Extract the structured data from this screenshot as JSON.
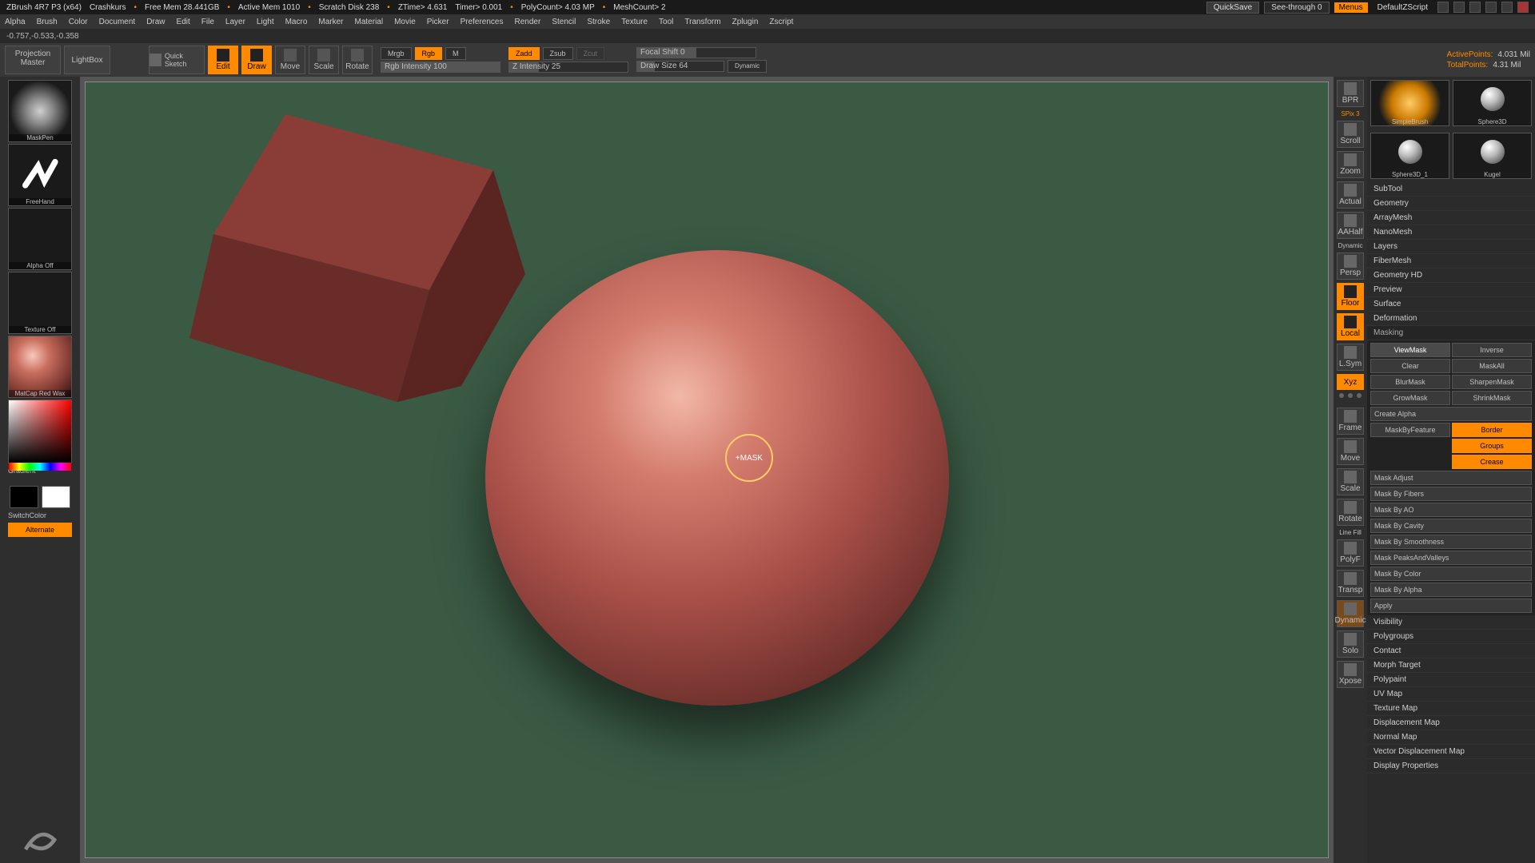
{
  "title": {
    "app": "ZBrush 4R7 P3 (x64)",
    "doc": "Crashkurs",
    "free_mem": "Free Mem 28.441GB",
    "active_mem": "Active Mem 1010",
    "scratch": "Scratch Disk 238",
    "ztime": "ZTime> 4.631",
    "timer": "Timer> 0.001",
    "polycount": "PolyCount> 4.03 MP",
    "meshcount": "MeshCount> 2",
    "quicksave": "QuickSave",
    "seethrough": "See-through  0",
    "menus": "Menus",
    "script": "DefaultZScript"
  },
  "menu": [
    "Alpha",
    "Brush",
    "Color",
    "Document",
    "Draw",
    "Edit",
    "File",
    "Layer",
    "Light",
    "Macro",
    "Marker",
    "Material",
    "Movie",
    "Picker",
    "Preferences",
    "Render",
    "Stencil",
    "Stroke",
    "Texture",
    "Tool",
    "Transform",
    "Zplugin",
    "Zscript"
  ],
  "status": "-0.757,-0.533,-0.358",
  "top": {
    "projection": "Projection Master",
    "lightbox": "LightBox",
    "quicksketch": "Quick Sketch",
    "modes": {
      "edit": "Edit",
      "draw": "Draw",
      "move": "Move",
      "scale": "Scale",
      "rotate": "Rotate"
    },
    "mrgb": "Mrgb",
    "rgb": "Rgb",
    "m": "M",
    "rgbint": "Rgb Intensity 100",
    "zadd": "Zadd",
    "zsub": "Zsub",
    "zcut": "Zcut",
    "zint": "Z Intensity 25",
    "focal": "Focal Shift 0",
    "drawsize": "Draw Size 64",
    "dynamic": "Dynamic",
    "active_pts_label": "ActivePoints:",
    "active_pts": "4.031 Mil",
    "total_pts_label": "TotalPoints:",
    "total_pts": "4.31 Mil"
  },
  "left": {
    "brush": "MaskPen",
    "stroke": "FreeHand",
    "alpha": "Alpha Off",
    "texture": "Texture Off",
    "material": "MatCap Red Wax",
    "gradient": "Gradient",
    "switch": "SwitchColor",
    "alternate": "Alternate"
  },
  "cursor": {
    "text": "+MASK"
  },
  "rail": {
    "bpr": "BPR",
    "spix": "SPix 3",
    "scroll": "Scroll",
    "zoom": "Zoom",
    "actual": "Actual",
    "aahalf": "AAHalf",
    "dynamic": "Dynamic",
    "persp": "Persp",
    "floor": "Floor",
    "local": "Local",
    "lsym": "L.Sym",
    "xyz": "Xyz",
    "frame": "Frame",
    "move": "Move",
    "scale": "Scale",
    "rotate": "Rotate",
    "linefill": "Line Fill",
    "polyf": "PolyF",
    "transp": "Transp",
    "dyn2": "Dynamic",
    "solo": "Solo",
    "xpose": "Xpose"
  },
  "tools": {
    "t1": "SimpleBrush",
    "t2": "Sphere3D",
    "t3": "Sphere3D_1",
    "t4": "Kugel"
  },
  "panel": {
    "sections": [
      "SubTool",
      "Geometry",
      "ArrayMesh",
      "NanoMesh",
      "Layers",
      "FiberMesh",
      "Geometry HD",
      "Preview",
      "Surface",
      "Deformation"
    ],
    "masking": {
      "title": "Masking",
      "viewmask": "ViewMask",
      "inverse": "Inverse",
      "clear": "Clear",
      "maskall": "MaskAll",
      "blurmask": "BlurMask",
      "sharpen": "SharpenMask",
      "grow": "GrowMask",
      "shrink": "ShrinkMask",
      "createalpha": "Create Alpha",
      "maskbyfeature": "MaskByFeature",
      "border": "Border",
      "groups": "Groups",
      "crease": "Crease",
      "adjust": "Mask Adjust",
      "byfibers": "Mask By Fibers",
      "byao": "Mask By AO",
      "bycavity": "Mask By Cavity",
      "bysmooth": "Mask By Smoothness",
      "peaks": "Mask PeaksAndValleys",
      "bycolor": "Mask By Color",
      "byalpha": "Mask By Alpha",
      "apply": "Apply"
    },
    "after": [
      "Visibility",
      "Polygroups",
      "Contact",
      "Morph Target",
      "Polypaint",
      "UV Map",
      "Texture Map",
      "Displacement Map",
      "Normal Map",
      "Vector Displacement Map",
      "Display Properties"
    ]
  }
}
